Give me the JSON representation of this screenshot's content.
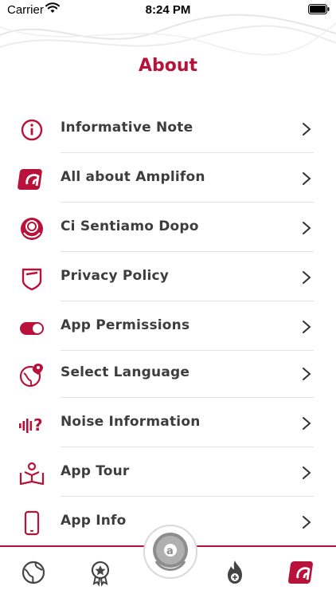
{
  "status": {
    "carrier": "Carrier",
    "time": "8:24 PM"
  },
  "page": {
    "title": "About"
  },
  "menu": {
    "items": [
      {
        "label": "Informative Note",
        "icon": "info-icon"
      },
      {
        "label": "All about Amplifon",
        "icon": "amplifon-logo-icon"
      },
      {
        "label": "Ci Sentiamo Dopo",
        "icon": "ci-sentiamo-dopo-icon"
      },
      {
        "label": "Privacy Policy",
        "icon": "shield-icon"
      },
      {
        "label": "App Permissions",
        "icon": "toggle-icon"
      },
      {
        "label": "Select Language",
        "icon": "globe-pin-icon"
      },
      {
        "label": "Noise Information",
        "icon": "noise-icon"
      },
      {
        "label": "App Tour",
        "icon": "tour-book-icon"
      },
      {
        "label": "App Info",
        "icon": "phone-icon"
      }
    ]
  },
  "tabbar": {
    "tabs": [
      "globe-tab-icon",
      "badge-tab-icon",
      "amplifon-ball-tab-icon",
      "fire-tab-icon",
      "amplifon-logo-tab-icon"
    ],
    "active_tab": "amplifon-logo-tab-icon"
  },
  "colors": {
    "accent": "#b8123a",
    "text": "#3d3d3d",
    "divider": "#e2e2e2"
  }
}
